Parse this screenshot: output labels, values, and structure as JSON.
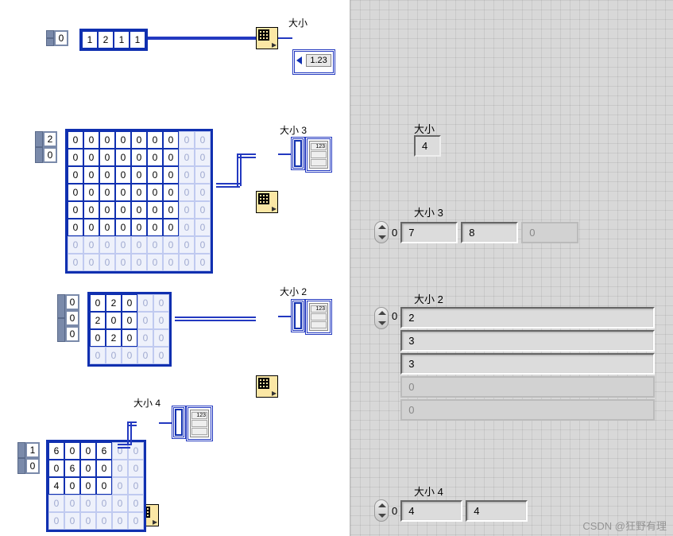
{
  "bd": {
    "size1": {
      "label": "大小",
      "idx": "0",
      "cells": [
        "1",
        "2",
        "1",
        "1"
      ],
      "indicator": "1.23"
    },
    "size3": {
      "label": "大小 3",
      "idx": [
        "2",
        "0"
      ],
      "rows": 8,
      "cols": 9,
      "active_rows": 6,
      "active_cols": 7
    },
    "size2": {
      "label": "大小 2",
      "idx": [
        "0",
        "0",
        "0"
      ],
      "rows": 4,
      "cols": 5,
      "active_rows": 3,
      "active_cols": 3,
      "grid": [
        [
          "0",
          "2",
          "0"
        ],
        [
          "2",
          "0",
          "0"
        ],
        [
          "0",
          "2",
          "0"
        ]
      ]
    },
    "size4": {
      "label": "大小 4",
      "idx": [
        "1",
        "0"
      ],
      "rows": 5,
      "cols": 6,
      "active_rows": 3,
      "active_cols": 4,
      "grid": [
        [
          "6",
          "0",
          "0",
          "6"
        ],
        [
          "0",
          "6",
          "0",
          "0"
        ],
        [
          "4",
          "0",
          "0",
          "0"
        ]
      ]
    }
  },
  "fp": {
    "size1": {
      "label": "大小",
      "value": "4"
    },
    "size3": {
      "label": "大小 3",
      "idx": "0",
      "cells": [
        "7",
        "8",
        "0"
      ]
    },
    "size2": {
      "label": "大小 2",
      "idx": "0",
      "cells": [
        "2",
        "3",
        "3",
        "0",
        "0"
      ]
    },
    "size4": {
      "label": "大小 4",
      "idx": "0",
      "cells": [
        "4",
        "4"
      ]
    }
  },
  "watermark": "CSDN @狂野有理"
}
